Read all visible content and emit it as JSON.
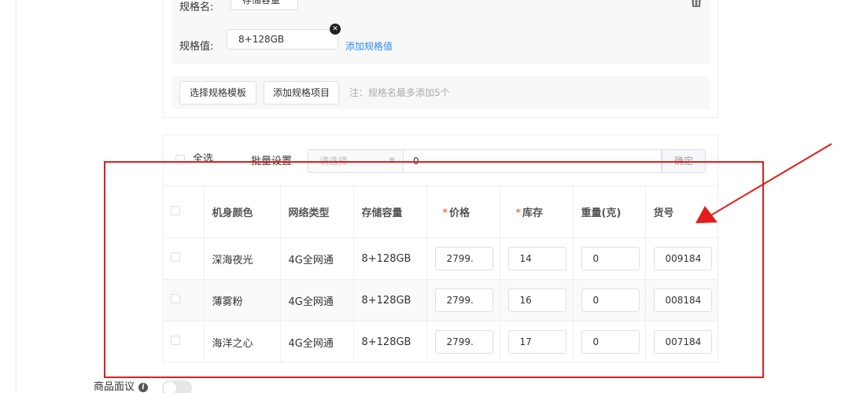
{
  "spec": {
    "name_label": "规格名:",
    "name_value": "存储容量",
    "value_label": "规格值:",
    "value_tag": "8+128GB",
    "add_value_link": "添加规格值",
    "select_template_button": "选择规格模板",
    "add_item_button": "添加规格项目",
    "note": "注：规格名最多添加5个"
  },
  "batch": {
    "select_all": "全选",
    "label": "批量设置",
    "select_placeholder": "请选择",
    "input_value": "0",
    "confirm": "确定"
  },
  "table": {
    "headers": {
      "color": "机身颜色",
      "network": "网络类型",
      "storage": "存储容量",
      "price": "价格",
      "stock": "库存",
      "weight": "重量(克)",
      "sku_code": "货号"
    },
    "required_mark": "*",
    "rows": [
      {
        "color": "深海夜光",
        "network": "4G全网通",
        "storage": "8+128GB",
        "price": "2799.",
        "stock": "14",
        "weight": "0",
        "sku_code": "009184"
      },
      {
        "color": "薄雾粉",
        "network": "4G全网通",
        "storage": "8+128GB",
        "price": "2799.",
        "stock": "16",
        "weight": "0",
        "sku_code": "008184"
      },
      {
        "color": "海洋之心",
        "network": "4G全网通",
        "storage": "8+128GB",
        "price": "2799.",
        "stock": "17",
        "weight": "0",
        "sku_code": "007184"
      }
    ]
  },
  "footer": {
    "comment_label": "商品面议",
    "comment_enabled": false
  },
  "colors": {
    "highlight": "#e31c1c",
    "link": "#2d8cf0",
    "required": "#ed4014"
  },
  "icons": [
    "trash-icon",
    "close-circle-icon",
    "chevron-down-icon",
    "info-icon",
    "arrow-annotation"
  ]
}
